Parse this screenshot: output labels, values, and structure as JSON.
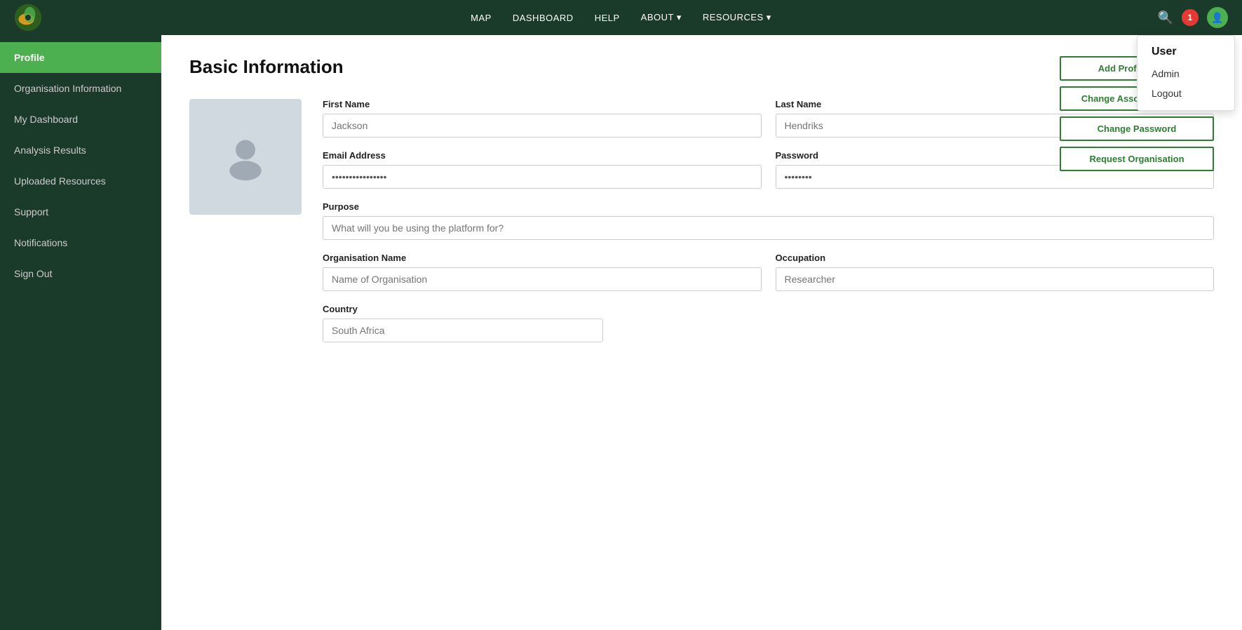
{
  "nav": {
    "links": [
      {
        "label": "MAP",
        "id": "nav-map"
      },
      {
        "label": "DASHBOARD",
        "id": "nav-dashboard"
      },
      {
        "label": "HELP",
        "id": "nav-help"
      },
      {
        "label": "ABOUT ▾",
        "id": "nav-about"
      },
      {
        "label": "RESOURCES ▾",
        "id": "nav-resources"
      }
    ],
    "notification_count": "1"
  },
  "sidebar": {
    "items": [
      {
        "label": "Profile",
        "active": true,
        "id": "profile"
      },
      {
        "label": "Organisation Information",
        "active": false,
        "id": "org-info"
      },
      {
        "label": "My Dashboard",
        "active": false,
        "id": "my-dashboard"
      },
      {
        "label": "Analysis Results",
        "active": false,
        "id": "analysis-results"
      },
      {
        "label": "Uploaded Resources",
        "active": false,
        "id": "uploaded-resources"
      },
      {
        "label": "Support",
        "active": false,
        "id": "support"
      },
      {
        "label": "Notifications",
        "active": false,
        "id": "notifications"
      },
      {
        "label": "Sign Out",
        "active": false,
        "id": "sign-out"
      }
    ]
  },
  "main": {
    "title": "Basic Information",
    "form": {
      "first_name_label": "First Name",
      "first_name_placeholder": "Jackson",
      "last_name_label": "Last Name",
      "last_name_placeholder": "Hendriks",
      "email_label": "Email Address",
      "email_placeholder": "••••••••••••",
      "password_label": "Password",
      "password_value": "••••••••",
      "purpose_label": "Purpose",
      "purpose_placeholder": "What will you be using the platform for?",
      "org_name_label": "Organisation Name",
      "org_name_placeholder": "Name of Organisation",
      "occupation_label": "Occupation",
      "occupation_placeholder": "Researcher",
      "country_label": "Country",
      "country_value": "South Africa"
    },
    "action_buttons": [
      {
        "label": "Add Profile Image",
        "id": "add-profile-image"
      },
      {
        "label": "Change Associated Email",
        "id": "change-email"
      },
      {
        "label": "Change Password",
        "id": "change-password"
      },
      {
        "label": "Request Organisation",
        "id": "request-org"
      }
    ]
  },
  "user_dropdown": {
    "title": "User",
    "items": [
      {
        "label": "Admin",
        "id": "admin"
      },
      {
        "label": "Logout",
        "id": "logout"
      }
    ]
  }
}
